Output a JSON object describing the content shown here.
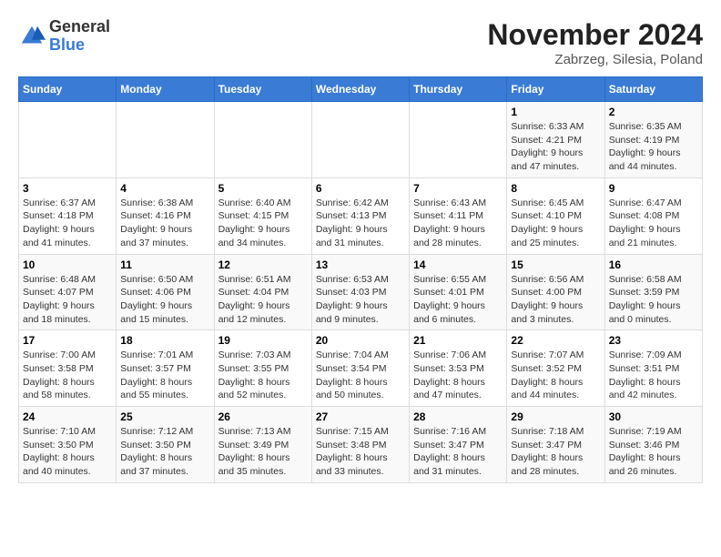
{
  "header": {
    "logo": {
      "general": "General",
      "blue": "Blue"
    },
    "title": "November 2024",
    "subtitle": "Zabrzeg, Silesia, Poland"
  },
  "days_of_week": [
    "Sunday",
    "Monday",
    "Tuesday",
    "Wednesday",
    "Thursday",
    "Friday",
    "Saturday"
  ],
  "weeks": [
    [
      {
        "day": null,
        "info": ""
      },
      {
        "day": null,
        "info": ""
      },
      {
        "day": null,
        "info": ""
      },
      {
        "day": null,
        "info": ""
      },
      {
        "day": null,
        "info": ""
      },
      {
        "day": "1",
        "sunrise": "6:33 AM",
        "sunset": "4:21 PM",
        "daylight": "9 hours and 47 minutes."
      },
      {
        "day": "2",
        "sunrise": "6:35 AM",
        "sunset": "4:19 PM",
        "daylight": "9 hours and 44 minutes."
      }
    ],
    [
      {
        "day": "3",
        "sunrise": "6:37 AM",
        "sunset": "4:18 PM",
        "daylight": "9 hours and 41 minutes."
      },
      {
        "day": "4",
        "sunrise": "6:38 AM",
        "sunset": "4:16 PM",
        "daylight": "9 hours and 37 minutes."
      },
      {
        "day": "5",
        "sunrise": "6:40 AM",
        "sunset": "4:15 PM",
        "daylight": "9 hours and 34 minutes."
      },
      {
        "day": "6",
        "sunrise": "6:42 AM",
        "sunset": "4:13 PM",
        "daylight": "9 hours and 31 minutes."
      },
      {
        "day": "7",
        "sunrise": "6:43 AM",
        "sunset": "4:11 PM",
        "daylight": "9 hours and 28 minutes."
      },
      {
        "day": "8",
        "sunrise": "6:45 AM",
        "sunset": "4:10 PM",
        "daylight": "9 hours and 25 minutes."
      },
      {
        "day": "9",
        "sunrise": "6:47 AM",
        "sunset": "4:08 PM",
        "daylight": "9 hours and 21 minutes."
      }
    ],
    [
      {
        "day": "10",
        "sunrise": "6:48 AM",
        "sunset": "4:07 PM",
        "daylight": "9 hours and 18 minutes."
      },
      {
        "day": "11",
        "sunrise": "6:50 AM",
        "sunset": "4:06 PM",
        "daylight": "9 hours and 15 minutes."
      },
      {
        "day": "12",
        "sunrise": "6:51 AM",
        "sunset": "4:04 PM",
        "daylight": "9 hours and 12 minutes."
      },
      {
        "day": "13",
        "sunrise": "6:53 AM",
        "sunset": "4:03 PM",
        "daylight": "9 hours and 9 minutes."
      },
      {
        "day": "14",
        "sunrise": "6:55 AM",
        "sunset": "4:01 PM",
        "daylight": "9 hours and 6 minutes."
      },
      {
        "day": "15",
        "sunrise": "6:56 AM",
        "sunset": "4:00 PM",
        "daylight": "9 hours and 3 minutes."
      },
      {
        "day": "16",
        "sunrise": "6:58 AM",
        "sunset": "3:59 PM",
        "daylight": "9 hours and 0 minutes."
      }
    ],
    [
      {
        "day": "17",
        "sunrise": "7:00 AM",
        "sunset": "3:58 PM",
        "daylight": "8 hours and 58 minutes."
      },
      {
        "day": "18",
        "sunrise": "7:01 AM",
        "sunset": "3:57 PM",
        "daylight": "8 hours and 55 minutes."
      },
      {
        "day": "19",
        "sunrise": "7:03 AM",
        "sunset": "3:55 PM",
        "daylight": "8 hours and 52 minutes."
      },
      {
        "day": "20",
        "sunrise": "7:04 AM",
        "sunset": "3:54 PM",
        "daylight": "8 hours and 50 minutes."
      },
      {
        "day": "21",
        "sunrise": "7:06 AM",
        "sunset": "3:53 PM",
        "daylight": "8 hours and 47 minutes."
      },
      {
        "day": "22",
        "sunrise": "7:07 AM",
        "sunset": "3:52 PM",
        "daylight": "8 hours and 44 minutes."
      },
      {
        "day": "23",
        "sunrise": "7:09 AM",
        "sunset": "3:51 PM",
        "daylight": "8 hours and 42 minutes."
      }
    ],
    [
      {
        "day": "24",
        "sunrise": "7:10 AM",
        "sunset": "3:50 PM",
        "daylight": "8 hours and 40 minutes."
      },
      {
        "day": "25",
        "sunrise": "7:12 AM",
        "sunset": "3:50 PM",
        "daylight": "8 hours and 37 minutes."
      },
      {
        "day": "26",
        "sunrise": "7:13 AM",
        "sunset": "3:49 PM",
        "daylight": "8 hours and 35 minutes."
      },
      {
        "day": "27",
        "sunrise": "7:15 AM",
        "sunset": "3:48 PM",
        "daylight": "8 hours and 33 minutes."
      },
      {
        "day": "28",
        "sunrise": "7:16 AM",
        "sunset": "3:47 PM",
        "daylight": "8 hours and 31 minutes."
      },
      {
        "day": "29",
        "sunrise": "7:18 AM",
        "sunset": "3:47 PM",
        "daylight": "8 hours and 28 minutes."
      },
      {
        "day": "30",
        "sunrise": "7:19 AM",
        "sunset": "3:46 PM",
        "daylight": "8 hours and 26 minutes."
      }
    ]
  ]
}
